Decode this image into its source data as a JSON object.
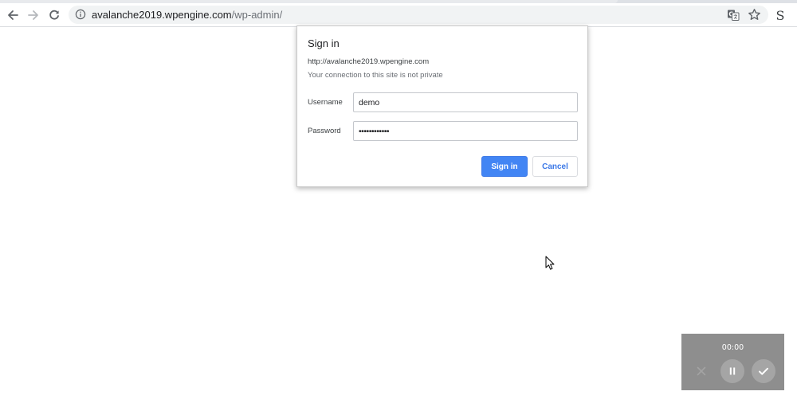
{
  "browser": {
    "url_host": "avalanche2019.wpengine.com",
    "url_path": "/wp-admin/",
    "profile_initial": "S",
    "icons": {
      "back": "arrow-left-icon",
      "forward": "arrow-right-icon",
      "reload": "reload-icon",
      "site_info": "info-icon",
      "translate": "translate-icon",
      "bookmark": "star-icon"
    }
  },
  "auth_dialog": {
    "title": "Sign in",
    "origin": "http://avalanche2019.wpengine.com",
    "warning": "Your connection to this site is not private",
    "username_label": "Username",
    "username_value": "demo",
    "password_label": "Password",
    "password_value": "••••••••••••",
    "sign_in_label": "Sign in",
    "cancel_label": "Cancel"
  },
  "recorder": {
    "time": "00:00",
    "icons": {
      "discard": "close-icon",
      "pause": "pause-icon",
      "finish": "check-icon"
    }
  },
  "colors": {
    "accent": "#4285f4",
    "omnibox_bg": "#f1f3f4",
    "recorder_bg": "#8e8e8e"
  }
}
